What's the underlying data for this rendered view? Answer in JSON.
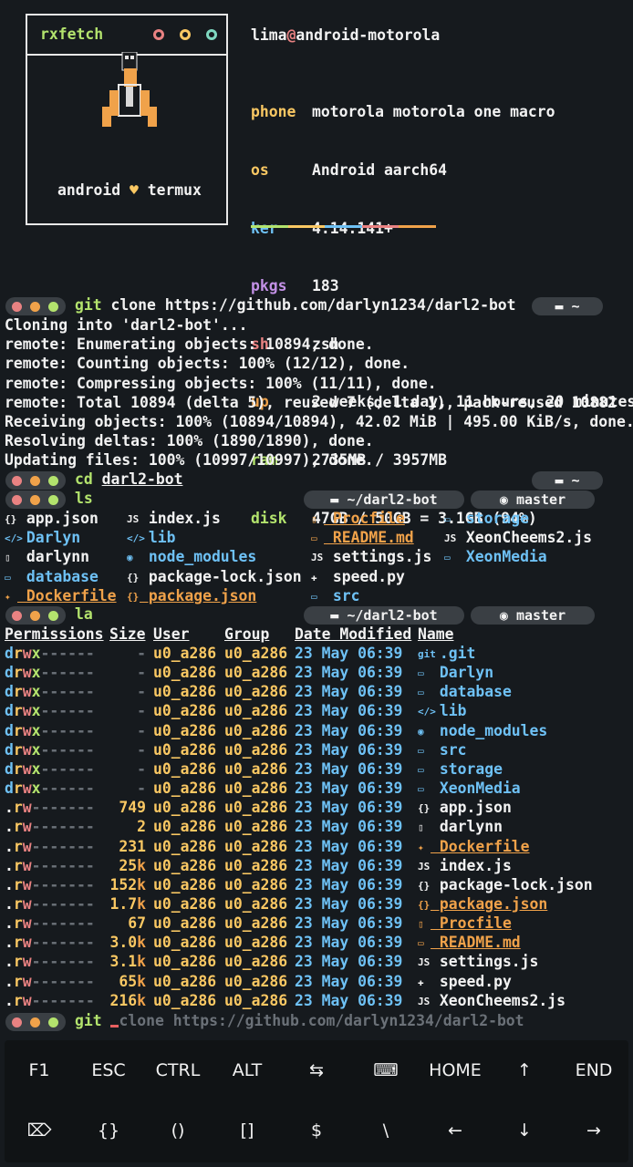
{
  "fetch": {
    "title": "rxfetch",
    "caption_a": "android",
    "heart": "♥",
    "caption_b": "termux",
    "user": "lima",
    "at": "@",
    "host": "android-motorola",
    "info": [
      {
        "key": "phone",
        "value": "motorola motorola one macro",
        "color": "#fac863"
      },
      {
        "key": "os",
        "value": "Android aarch64",
        "color": "#fac863"
      },
      {
        "key": "ker",
        "value": "4.14.141+",
        "color": "#6ec1f5"
      },
      {
        "key": "pkgs",
        "value": "183",
        "color": "#c391e6"
      },
      {
        "key": "sh",
        "value": "zsh",
        "color": "#e98282"
      },
      {
        "key": "up",
        "value": "2 weeks, 1 day, 11 hours, 20 minutes",
        "color": "#f0a24a"
      },
      {
        "key": "ram",
        "value": "2735MB / 3957MB",
        "color": "#b3e36d"
      },
      {
        "key": "disk",
        "value": "47GB / 50GB = 3.1GB (94%)",
        "color": "#b3e36d"
      }
    ],
    "colors": [
      "#b3e36d",
      "#fac863",
      "#6ec1f5",
      "#e98282",
      "#f0a24a"
    ]
  },
  "prompts": {
    "dir_home": "~",
    "dir_bot": "~/darl2-bot",
    "branch": "master",
    "folder_icon": "folder-icon",
    "git_icon": "github-icon"
  },
  "cmd1": {
    "exe": "git",
    "args": "clone https://github.com/darlyn1234/darl2-bot"
  },
  "clone_output": [
    "Cloning into 'darl2-bot'...",
    "remote: Enumerating objects: 10894, done.",
    "remote: Counting objects: 100% (12/12), done.",
    "remote: Compressing objects: 100% (11/11), done.",
    "remote: Total 10894 (delta 5), reused 7 (delta 1), pack-reused 10882",
    "Receiving objects: 100% (10894/10894), 42.02 MiB | 495.00 KiB/s, done.",
    "Resolving deltas: 100% (1890/1890), done.",
    "Updating files: 100% (10997/10997), done."
  ],
  "cmd2": {
    "exe": "cd",
    "args": "darl2-bot"
  },
  "cmd3": {
    "exe": "ls"
  },
  "ls_items": [
    {
      "icon": "{}",
      "name": "app.json",
      "kind": "file"
    },
    {
      "icon": "</>",
      "name": "Darlyn",
      "kind": "dir"
    },
    {
      "icon": "▯",
      "name": "darlynn",
      "kind": "file"
    },
    {
      "icon": "▭",
      "name": "database",
      "kind": "dir"
    },
    {
      "icon": "✦",
      "name": "Dockerfile",
      "kind": "special"
    },
    {
      "icon": "JS",
      "name": "index.js",
      "kind": "file"
    },
    {
      "icon": "</>",
      "name": "lib",
      "kind": "dir"
    },
    {
      "icon": "◉",
      "name": "node_modules",
      "kind": "dir"
    },
    {
      "icon": "{}",
      "name": "package-lock.json",
      "kind": "file"
    },
    {
      "icon": "{}",
      "name": "package.json",
      "kind": "special"
    },
    {
      "icon": "▯",
      "name": "Procfile",
      "kind": "special"
    },
    {
      "icon": "▭",
      "name": "README.md",
      "kind": "special"
    },
    {
      "icon": "JS",
      "name": "settings.js",
      "kind": "file"
    },
    {
      "icon": "✚",
      "name": "speed.py",
      "kind": "file"
    },
    {
      "icon": "▭",
      "name": "src",
      "kind": "dir"
    },
    {
      "icon": "▭",
      "name": "storage",
      "kind": "dir"
    },
    {
      "icon": "JS",
      "name": "XeonCheems2.js",
      "kind": "file"
    },
    {
      "icon": "▭",
      "name": "XeonMedia",
      "kind": "dir"
    }
  ],
  "cmd4": {
    "exe": "la"
  },
  "la_headers": [
    "Permissions",
    "Size",
    "User",
    "Group",
    "Date Modified",
    "Name"
  ],
  "la_rows": [
    {
      "perm": "drwx------",
      "size": "-",
      "user": "u0_a286",
      "group": "u0_a286",
      "date": "23 May 06:39",
      "icon": "git",
      "name": ".git",
      "kind": "dir"
    },
    {
      "perm": "drwx------",
      "size": "-",
      "user": "u0_a286",
      "group": "u0_a286",
      "date": "23 May 06:39",
      "icon": "▭",
      "name": "Darlyn",
      "kind": "dir"
    },
    {
      "perm": "drwx------",
      "size": "-",
      "user": "u0_a286",
      "group": "u0_a286",
      "date": "23 May 06:39",
      "icon": "▭",
      "name": "database",
      "kind": "dir"
    },
    {
      "perm": "drwx------",
      "size": "-",
      "user": "u0_a286",
      "group": "u0_a286",
      "date": "23 May 06:39",
      "icon": "</>",
      "name": "lib",
      "kind": "dir"
    },
    {
      "perm": "drwx------",
      "size": "-",
      "user": "u0_a286",
      "group": "u0_a286",
      "date": "23 May 06:39",
      "icon": "◉",
      "name": "node_modules",
      "kind": "dir"
    },
    {
      "perm": "drwx------",
      "size": "-",
      "user": "u0_a286",
      "group": "u0_a286",
      "date": "23 May 06:39",
      "icon": "▭",
      "name": "src",
      "kind": "dir"
    },
    {
      "perm": "drwx------",
      "size": "-",
      "user": "u0_a286",
      "group": "u0_a286",
      "date": "23 May 06:39",
      "icon": "▭",
      "name": "storage",
      "kind": "dir"
    },
    {
      "perm": "drwx------",
      "size": "-",
      "user": "u0_a286",
      "group": "u0_a286",
      "date": "23 May 06:39",
      "icon": "▭",
      "name": "XeonMedia",
      "kind": "dir"
    },
    {
      "perm": ".rw-------",
      "size": "749",
      "user": "u0_a286",
      "group": "u0_a286",
      "date": "23 May 06:39",
      "icon": "{}",
      "name": "app.json",
      "kind": "file"
    },
    {
      "perm": ".rw-------",
      "size": "2",
      "user": "u0_a286",
      "group": "u0_a286",
      "date": "23 May 06:39",
      "icon": "▯",
      "name": "darlynn",
      "kind": "file"
    },
    {
      "perm": ".rw-------",
      "size": "231",
      "user": "u0_a286",
      "group": "u0_a286",
      "date": "23 May 06:39",
      "icon": "✦",
      "name": "Dockerfile",
      "kind": "special"
    },
    {
      "perm": ".rw-------",
      "size": "25k",
      "user": "u0_a286",
      "group": "u0_a286",
      "date": "23 May 06:39",
      "icon": "JS",
      "name": "index.js",
      "kind": "file"
    },
    {
      "perm": ".rw-------",
      "size": "152k",
      "user": "u0_a286",
      "group": "u0_a286",
      "date": "23 May 06:39",
      "icon": "{}",
      "name": "package-lock.json",
      "kind": "file"
    },
    {
      "perm": ".rw-------",
      "size": "1.7k",
      "user": "u0_a286",
      "group": "u0_a286",
      "date": "23 May 06:39",
      "icon": "{}",
      "name": "package.json",
      "kind": "special"
    },
    {
      "perm": ".rw-------",
      "size": "67",
      "user": "u0_a286",
      "group": "u0_a286",
      "date": "23 May 06:39",
      "icon": "▯",
      "name": "Procfile",
      "kind": "special"
    },
    {
      "perm": ".rw-------",
      "size": "3.0k",
      "user": "u0_a286",
      "group": "u0_a286",
      "date": "23 May 06:39",
      "icon": "▭",
      "name": "README.md",
      "kind": "special"
    },
    {
      "perm": ".rw-------",
      "size": "3.1k",
      "user": "u0_a286",
      "group": "u0_a286",
      "date": "23 May 06:39",
      "icon": "JS",
      "name": "settings.js",
      "kind": "file"
    },
    {
      "perm": ".rw-------",
      "size": "65k",
      "user": "u0_a286",
      "group": "u0_a286",
      "date": "23 May 06:39",
      "icon": "✚",
      "name": "speed.py",
      "kind": "file"
    },
    {
      "perm": ".rw-------",
      "size": "216k",
      "user": "u0_a286",
      "group": "u0_a286",
      "date": "23 May 06:39",
      "icon": "JS",
      "name": "XeonCheems2.js",
      "kind": "file"
    }
  ],
  "cmd5": {
    "exe": "git",
    "args": "clone https://github.com/darlyn1234/darl2-bot"
  },
  "keyboard": {
    "row1": [
      "F1",
      "ESC",
      "CTRL",
      "ALT",
      "⇆",
      "⌨",
      "HOME",
      "↑",
      "END"
    ],
    "row2": [
      "⌦",
      "{}",
      "()",
      "[]",
      "$",
      "\\",
      "←",
      "↓",
      "→"
    ]
  }
}
